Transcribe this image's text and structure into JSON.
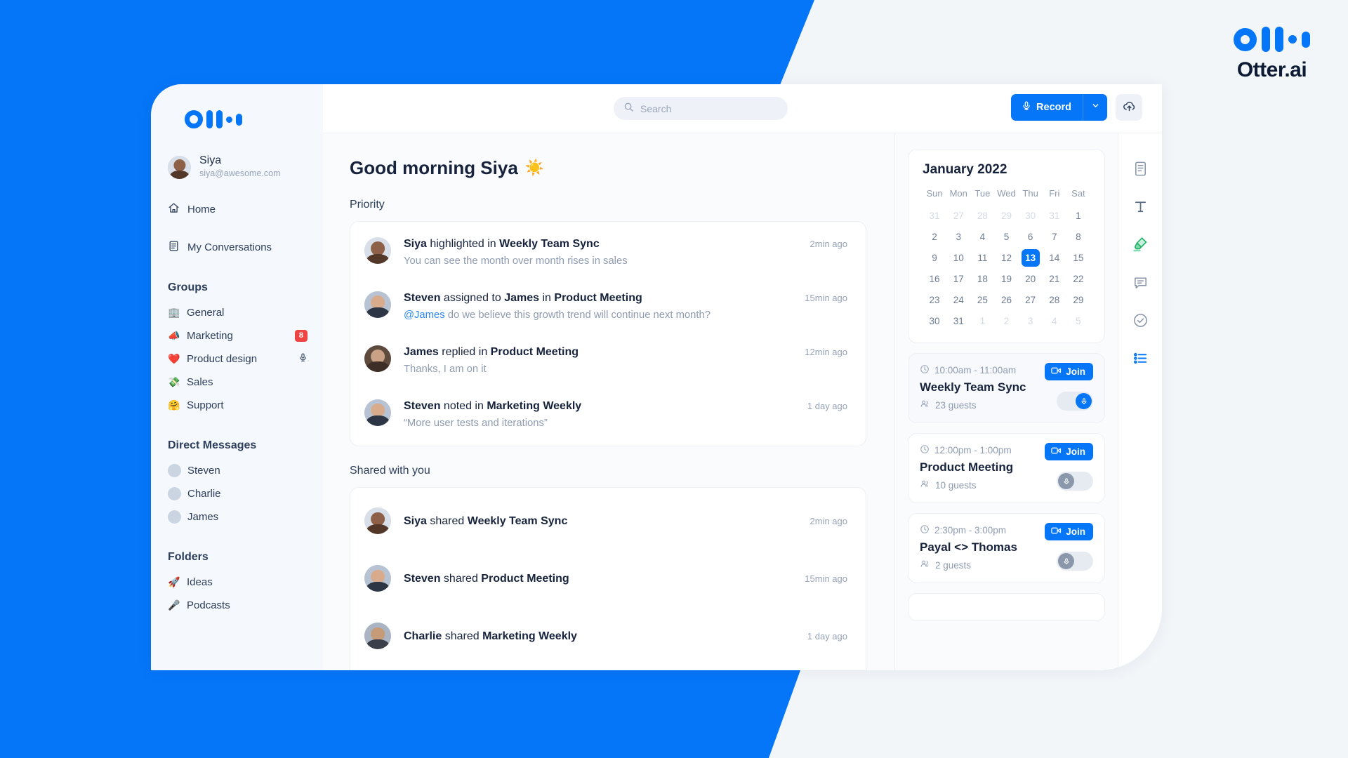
{
  "brand": {
    "name": "Otter.ai",
    "logo_icon": "otter-logo-icon",
    "accent": "#0576f8"
  },
  "sidebar": {
    "logo_icon": "otter-logo-icon",
    "user": {
      "name": "Siya",
      "email": "siya@awesome.com",
      "avatar": "avatar-siya"
    },
    "nav": [
      {
        "label": "Home",
        "icon": "home-icon"
      },
      {
        "label": "My Conversations",
        "icon": "document-icon"
      }
    ],
    "groups": {
      "title": "Groups",
      "items": [
        {
          "emoji": "🏢",
          "label": "General",
          "badge": "",
          "mic": false
        },
        {
          "emoji": "📣",
          "label": "Marketing",
          "badge": "8",
          "mic": false
        },
        {
          "emoji": "❤️",
          "label": "Product design",
          "badge": "",
          "mic": true
        },
        {
          "emoji": "💸",
          "label": "Sales",
          "badge": "",
          "mic": false
        },
        {
          "emoji": "🤗",
          "label": "Support",
          "badge": "",
          "mic": false
        }
      ]
    },
    "direct_messages": {
      "title": "Direct Messages",
      "items": [
        {
          "label": "Steven",
          "avatar": "avatar-steven"
        },
        {
          "label": "Charlie",
          "avatar": "avatar-charlie"
        },
        {
          "label": "James",
          "avatar": "avatar-james"
        }
      ]
    },
    "folders": {
      "title": "Folders",
      "items": [
        {
          "emoji": "🚀",
          "label": "Ideas"
        },
        {
          "emoji": "🎤",
          "label": "Podcasts"
        }
      ]
    }
  },
  "topbar": {
    "search": {
      "placeholder": "Search",
      "value": "",
      "icon": "search-icon"
    },
    "record_label": "Record",
    "record_icon": "microphone-icon",
    "record_caret_icon": "chevron-down-icon",
    "upload_icon": "cloud-upload-icon"
  },
  "main": {
    "greeting": "Good morning Siya",
    "greeting_emoji": "☀️",
    "priority_label": "Priority",
    "priority": [
      {
        "avatar": "avatar-siya",
        "actor": "Siya",
        "verb": "highlighted in",
        "target": "Weekly Team Sync",
        "detail": "You can see the month over month rises in sales",
        "mention": "",
        "time": "2min ago"
      },
      {
        "avatar": "avatar-steven",
        "actor": "Steven",
        "verb": "assigned to",
        "mid": "James",
        "verb2": "in",
        "target": "Product Meeting",
        "mention": "@James",
        "detail": " do we believe this growth trend will continue next month?",
        "time": "15min ago"
      },
      {
        "avatar": "avatar-james",
        "actor": "James",
        "verb": "replied in",
        "target": "Product Meeting",
        "detail": "Thanks, I am on it",
        "mention": "",
        "time": "12min ago"
      },
      {
        "avatar": "avatar-steven",
        "actor": "Steven",
        "verb": "noted in",
        "target": "Marketing Weekly",
        "detail": "“More user tests and iterations”",
        "mention": "",
        "time": "1 day ago"
      }
    ],
    "shared_label": "Shared with you",
    "shared": [
      {
        "avatar": "avatar-siya",
        "actor": "Siya",
        "verb": "shared",
        "target": "Weekly Team Sync",
        "time": "2min ago"
      },
      {
        "avatar": "avatar-steven",
        "actor": "Steven",
        "verb": "shared",
        "target": "Product Meeting",
        "time": "15min ago"
      },
      {
        "avatar": "avatar-charlie",
        "actor": "Charlie",
        "verb": "shared",
        "target": "Marketing Weekly",
        "time": "1 day ago"
      },
      {
        "avatar": "avatar-james",
        "actor": "",
        "verb": "",
        "target": "",
        "time": ""
      }
    ]
  },
  "calendar": {
    "month_title": "January 2022",
    "weekdays": [
      "Sun",
      "Mon",
      "Tue",
      "Wed",
      "Thu",
      "Fri",
      "Sat"
    ],
    "weeks": [
      [
        {
          "d": "31",
          "m": true
        },
        {
          "d": "27",
          "m": true
        },
        {
          "d": "28",
          "m": true
        },
        {
          "d": "29",
          "m": true
        },
        {
          "d": "30",
          "m": true
        },
        {
          "d": "31",
          "m": true
        },
        {
          "d": "1",
          "m": false
        }
      ],
      [
        {
          "d": "2",
          "m": false
        },
        {
          "d": "3",
          "m": false
        },
        {
          "d": "4",
          "m": false
        },
        {
          "d": "5",
          "m": false
        },
        {
          "d": "6",
          "m": false
        },
        {
          "d": "7",
          "m": false
        },
        {
          "d": "8",
          "m": false
        }
      ],
      [
        {
          "d": "9",
          "m": false
        },
        {
          "d": "10",
          "m": false
        },
        {
          "d": "11",
          "m": false
        },
        {
          "d": "12",
          "m": false
        },
        {
          "d": "13",
          "m": false,
          "today": true
        },
        {
          "d": "14",
          "m": false
        },
        {
          "d": "15",
          "m": false
        }
      ],
      [
        {
          "d": "16",
          "m": false
        },
        {
          "d": "17",
          "m": false
        },
        {
          "d": "18",
          "m": false
        },
        {
          "d": "19",
          "m": false
        },
        {
          "d": "20",
          "m": false
        },
        {
          "d": "21",
          "m": false
        },
        {
          "d": "22",
          "m": false
        }
      ],
      [
        {
          "d": "23",
          "m": false
        },
        {
          "d": "24",
          "m": false
        },
        {
          "d": "25",
          "m": false
        },
        {
          "d": "26",
          "m": false
        },
        {
          "d": "27",
          "m": false
        },
        {
          "d": "28",
          "m": false
        },
        {
          "d": "29",
          "m": false
        }
      ],
      [
        {
          "d": "30",
          "m": false
        },
        {
          "d": "31",
          "m": false
        },
        {
          "d": "1",
          "m": true
        },
        {
          "d": "2",
          "m": true
        },
        {
          "d": "3",
          "m": true
        },
        {
          "d": "4",
          "m": true
        },
        {
          "d": "5",
          "m": true
        }
      ]
    ],
    "selected_day": "13"
  },
  "meetings": {
    "join_label": "Join",
    "clock_icon": "clock-icon",
    "guests_icon": "people-icon",
    "camera_icon": "video-camera-icon",
    "mic_icon": "microphone-icon",
    "items": [
      {
        "time": "10:00am  - 11:00am",
        "title": "Weekly Team Sync",
        "guests": "23 guests",
        "recording": true,
        "highlighted": true
      },
      {
        "time": "12:00pm - 1:00pm",
        "title": "Product Meeting",
        "guests": "10 guests",
        "recording": false,
        "highlighted": false
      },
      {
        "time": "2:30pm - 3:00pm",
        "title": "Payal <> Thomas",
        "guests": "2 guests",
        "recording": false,
        "highlighted": false
      }
    ]
  },
  "icon_rail": [
    {
      "name": "notes-document-icon",
      "active": false
    },
    {
      "name": "text-tool-icon",
      "active": false
    },
    {
      "name": "highlighter-icon",
      "active": true
    },
    {
      "name": "comment-icon",
      "active": false
    },
    {
      "name": "checkmark-circle-icon",
      "active": false
    },
    {
      "name": "outline-list-icon",
      "active": true
    }
  ]
}
